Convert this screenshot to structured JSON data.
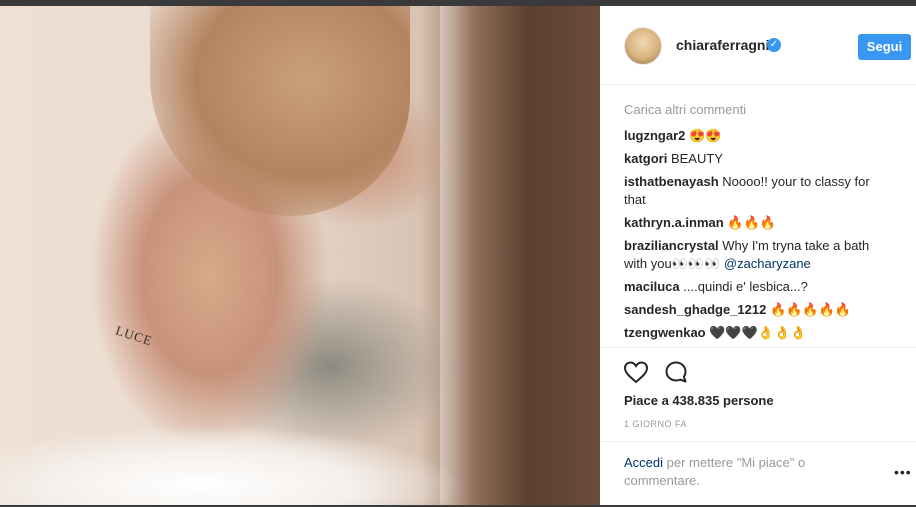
{
  "post": {
    "tattoo_text": "LUCE"
  },
  "header": {
    "username": "chiaraferragni",
    "verified_icon": "verified-check-icon",
    "follow_label": "Segui",
    "accent_color": "#3897f0"
  },
  "comments": {
    "load_more": "Carica altri commenti",
    "items": [
      {
        "user": "lugzngar2",
        "text": "😍😍",
        "mention": ""
      },
      {
        "user": "katgori",
        "text": "BEAUTY",
        "mention": ""
      },
      {
        "user": "isthatbenayash",
        "text": "Noooo!! your to classy for that",
        "mention": ""
      },
      {
        "user": "kathryn.a.inman",
        "text": "🔥🔥🔥",
        "mention": ""
      },
      {
        "user": "braziliancrystal",
        "text": "Why I'm tryna take a bath with you👀👀👀",
        "mention": "@zacharyzane"
      },
      {
        "user": "maciluca",
        "text": "....quindi e' lesbica...?",
        "mention": ""
      },
      {
        "user": "sandesh_ghadge_1212",
        "text": "🔥🔥🔥🔥🔥",
        "mention": ""
      },
      {
        "user": "tzengwenkao",
        "text": "🖤🖤🖤👌👌👌",
        "mention": ""
      }
    ]
  },
  "actions": {
    "like_icon": "heart-icon",
    "comment_icon": "speech-bubble-icon",
    "likes_text": "Piace a 438.835 persone",
    "time_text": "1 GIORNO FA"
  },
  "footer": {
    "login_link": "Accedi",
    "login_text": " per mettere \"Mi piace\" o commentare.",
    "more_icon": "more-options-icon",
    "more_glyph": "•••"
  }
}
